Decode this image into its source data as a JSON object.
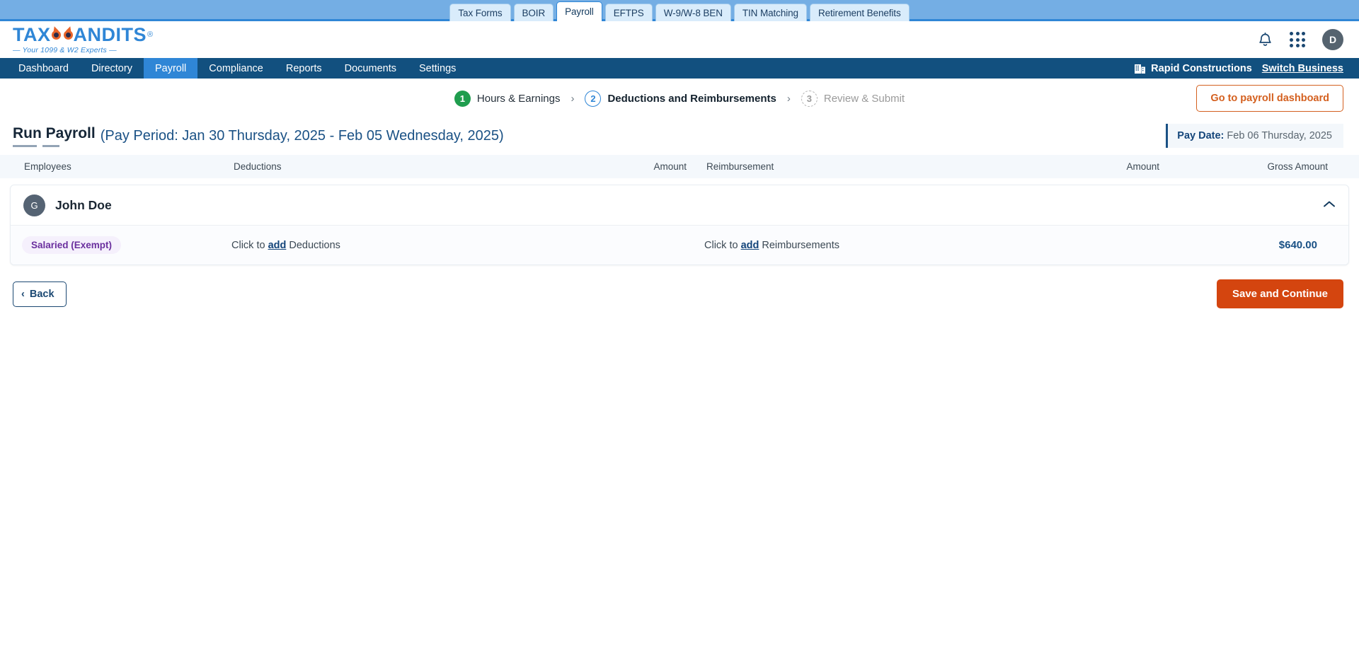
{
  "product_tabs": [
    {
      "label": "Tax Forms",
      "active": false
    },
    {
      "label": "BOIR",
      "active": false
    },
    {
      "label": "Payroll",
      "active": true
    },
    {
      "label": "EFTPS",
      "active": false
    },
    {
      "label": "W-9/W-8 BEN",
      "active": false
    },
    {
      "label": "TIN Matching",
      "active": false
    },
    {
      "label": "Retirement Benefits",
      "active": false
    }
  ],
  "brand": {
    "wordmark_left": "TAX",
    "wordmark_right": "ANDITS",
    "registered": "®",
    "tagline": "— Your 1099 & W2 Experts —",
    "logo_blue": "#2f86d6",
    "logo_orange": "#e8642a"
  },
  "header": {
    "notification_icon": "bell-icon",
    "apps_icon": "apps-grid-icon",
    "avatar_initial": "D"
  },
  "nav": {
    "items": [
      {
        "label": "Dashboard",
        "active": false
      },
      {
        "label": "Directory",
        "active": false
      },
      {
        "label": "Payroll",
        "active": true
      },
      {
        "label": "Compliance",
        "active": false
      },
      {
        "label": "Reports",
        "active": false
      },
      {
        "label": "Documents",
        "active": false
      },
      {
        "label": "Settings",
        "active": false
      }
    ],
    "business_name": "Rapid Constructions",
    "business_icon": "building-icon",
    "switch_business": "Switch Business"
  },
  "stepper": {
    "steps": [
      {
        "num": "1",
        "label": "Hours & Earnings",
        "state": "done"
      },
      {
        "num": "2",
        "label": "Deductions and Reimbursements",
        "state": "current"
      },
      {
        "num": "3",
        "label": "Review & Submit",
        "state": "todo"
      }
    ],
    "chevron": "›",
    "dashboard_button": "Go to payroll dashboard"
  },
  "page": {
    "title": "Run Payroll",
    "pay_period": "(Pay Period: Jan 30 Thursday, 2025 - Feb 05 Wednesday, 2025)",
    "pay_date_label": "Pay Date:",
    "pay_date_value": "Feb 06 Thursday, 2025"
  },
  "table": {
    "headers": {
      "employees": "Employees",
      "deductions": "Deductions",
      "amount1": "Amount",
      "reimbursement": "Reimbursement",
      "amount2": "Amount",
      "gross_amount": "Gross Amount"
    },
    "rows": [
      {
        "avatar_initial": "G",
        "name": "John Doe",
        "collapse_icon": "chevron-up-icon",
        "badge": "Salaried (Exempt)",
        "deductions_prefix": "Click to ",
        "deductions_link": "add",
        "deductions_suffix": " Deductions",
        "deductions_amount": "",
        "reimbursement_prefix": "Click to ",
        "reimbursement_link": "add",
        "reimbursement_suffix": " Reimbursements",
        "reimbursement_amount": "",
        "gross_amount": "$640.00"
      }
    ]
  },
  "footer": {
    "back_label": "Back",
    "back_chevron": "‹",
    "save_label": "Save and Continue"
  },
  "colors": {
    "accent_orange": "#d4450f",
    "nav_blue": "#12507f",
    "link_blue": "#14457a",
    "step_done_green": "#1f9d4e"
  }
}
